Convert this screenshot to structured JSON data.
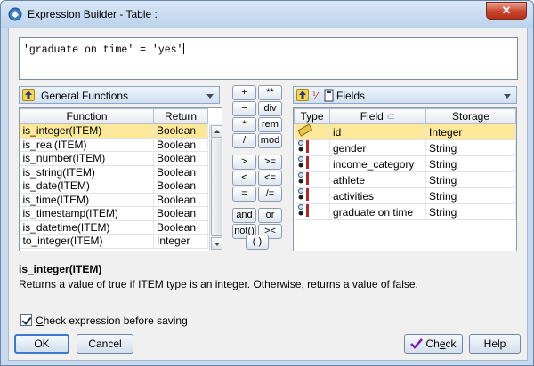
{
  "window": {
    "title": "Expression Builder - Table :",
    "close_label": "✕"
  },
  "expression": {
    "text": "'graduate on time' = 'yes'"
  },
  "functions": {
    "dropdown_label": "General Functions",
    "columns": [
      "Function",
      "Return"
    ],
    "rows": [
      [
        "is_integer(ITEM)",
        "Boolean"
      ],
      [
        "is_real(ITEM)",
        "Boolean"
      ],
      [
        "is_number(ITEM)",
        "Boolean"
      ],
      [
        "is_string(ITEM)",
        "Boolean"
      ],
      [
        "is_date(ITEM)",
        "Boolean"
      ],
      [
        "is_time(ITEM)",
        "Boolean"
      ],
      [
        "is_timestamp(ITEM)",
        "Boolean"
      ],
      [
        "is_datetime(ITEM)",
        "Boolean"
      ],
      [
        "to_integer(ITEM)",
        "Integer"
      ]
    ],
    "selected_index": 0
  },
  "operators": [
    "+",
    "**",
    "−",
    "div",
    "*",
    "rem",
    "/",
    "mod",
    ">",
    ">=",
    "<",
    "<=",
    "=",
    "/=",
    "and",
    "or",
    "not()",
    "><",
    "( )"
  ],
  "fields": {
    "dropdown_label": "Fields",
    "columns": [
      "Type",
      "Field",
      "Storage"
    ],
    "rows": [
      [
        "id",
        "Integer"
      ],
      [
        "gender",
        "String"
      ],
      [
        "income_category",
        "String"
      ],
      [
        "athlete",
        "String"
      ],
      [
        "activities",
        "String"
      ],
      [
        "graduate on time",
        "String"
      ]
    ],
    "selected_index": 0
  },
  "description": {
    "title": "is_integer(ITEM)",
    "text": "Returns a value of true if ITEM type is an integer. Otherwise, returns a value of false."
  },
  "checkbox": {
    "label_first": "C",
    "label_rest": "heck expression before saving",
    "checked": true
  },
  "buttons": {
    "ok": "OK",
    "cancel": "Cancel",
    "check_first": "Ch",
    "check_underline": "e",
    "check_rest": "ck",
    "help": "Help"
  },
  "colors": {
    "selection": "#fde89a",
    "accent": "#3b79c9"
  }
}
